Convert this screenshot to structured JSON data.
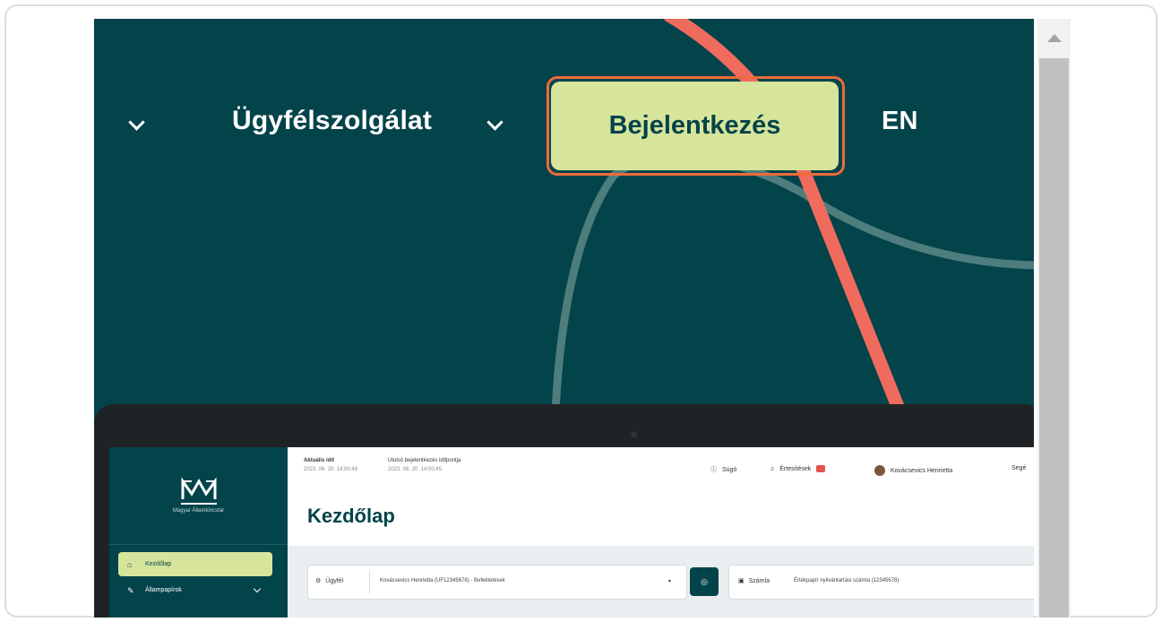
{
  "nav": {
    "partial_item_label": ":",
    "service_label": "Ügyfélszolgálat",
    "login_label": "Bejelentkezés",
    "language_label": "EN"
  },
  "colors": {
    "background": "#03434a",
    "login_button": "#d6e59b",
    "highlight_outline": "#ef6a3a",
    "deco_coral": "#ef6b5d",
    "deco_teal": "#4e7d7d"
  },
  "app": {
    "logo_text": "Magyar Államkincstár",
    "header": {
      "date_label": "Aktuális idő",
      "date_value": "2023. 06. 20. 14:00:48",
      "last_login_label": "Utolsó bejelentkezés időpontja",
      "last_login_value": "2023. 06. 20. 14:00:45",
      "help_label": "Súgó",
      "notifications_label": "Értesítések",
      "user_name": "Kovácsevics Henrietta",
      "extra_label": "Segé"
    },
    "page_title": "Kezdőlap",
    "sidebar": {
      "items": [
        {
          "label": "Kezdőlap",
          "icon": "home-icon"
        },
        {
          "label": "Állampapírok",
          "icon": "bonds-icon"
        }
      ]
    },
    "filters": {
      "client_label": "Ügyfél",
      "client_value": "Kovácsevics Henrietta (UF12345678) - Befektetések",
      "account_label": "Számla",
      "account_value": "Értékpapír nyilvántartási számla (12345678)"
    }
  }
}
